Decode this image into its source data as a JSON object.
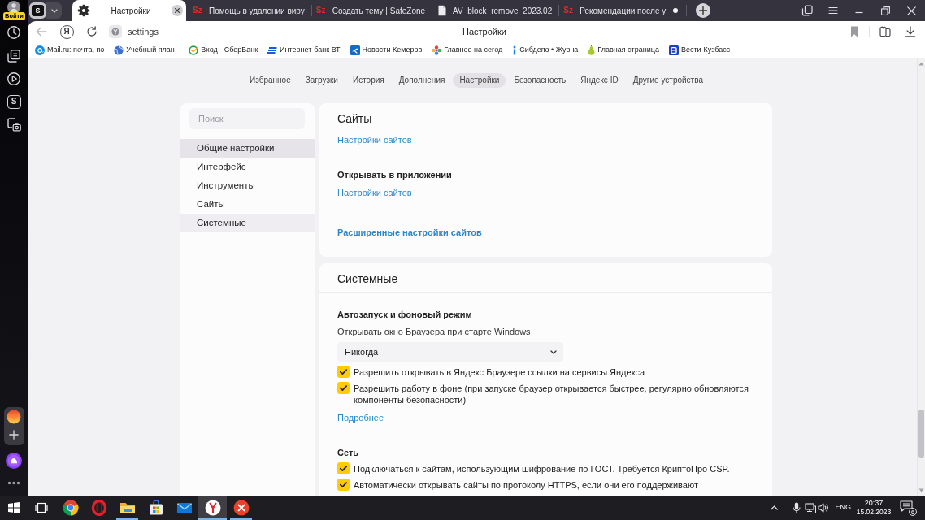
{
  "browser_sidebar": {
    "login_badge": "Войти",
    "panel_letter": "S"
  },
  "tab_strip": {
    "workspace_letter": "S",
    "tabs": [
      {
        "kind": "settings",
        "title": "Настройки",
        "selected": true,
        "unread": false
      },
      {
        "kind": "site",
        "icon_text": "Sz",
        "title": "Помощь в удалении виру",
        "selected": false,
        "unread": false
      },
      {
        "kind": "site",
        "icon_text": "Sz",
        "title": "Создать тему | SafeZone",
        "selected": false,
        "unread": false
      },
      {
        "kind": "document",
        "title": "AV_block_remove_2023.02",
        "selected": false,
        "unread": false
      },
      {
        "kind": "site",
        "icon_text": "Sz",
        "title": "Рекомендации после у",
        "selected": false,
        "unread": true
      }
    ]
  },
  "address_bar": {
    "home_letter": "Я",
    "url": "settings",
    "page_title": "Настройки"
  },
  "bookmarks": [
    {
      "kind": "mail",
      "label": "Mail.ru: почта, по"
    },
    {
      "kind": "globe",
      "label": "Учебный план -"
    },
    {
      "kind": "sber",
      "label": "Вход - СберБанк"
    },
    {
      "kind": "bank",
      "label": "Интернет-банк ВТ"
    },
    {
      "kind": "news",
      "label": "Новости Кемеров"
    },
    {
      "kind": "flower",
      "label": "Главное на сегод"
    },
    {
      "kind": "info",
      "label": "Сибдепо • Журна"
    },
    {
      "kind": "pear",
      "label": "Главная страница"
    },
    {
      "kind": "tile",
      "label": "Вести-Кузбасс"
    }
  ],
  "settings_nav": [
    {
      "label": "Избранное",
      "selected": false
    },
    {
      "label": "Загрузки",
      "selected": false
    },
    {
      "label": "История",
      "selected": false
    },
    {
      "label": "Дополнения",
      "selected": false
    },
    {
      "label": "Настройки",
      "selected": true
    },
    {
      "label": "Безопасность",
      "selected": false
    },
    {
      "label": "Яндекс ID",
      "selected": false
    },
    {
      "label": "Другие устройства",
      "selected": false
    }
  ],
  "settings_menu": {
    "search_placeholder": "Поиск",
    "items": [
      {
        "label": "Общие настройки",
        "selected": true,
        "hovered": false
      },
      {
        "label": "Интерфейс",
        "selected": false,
        "hovered": false
      },
      {
        "label": "Инструменты",
        "selected": false,
        "hovered": false
      },
      {
        "label": "Сайты",
        "selected": false,
        "hovered": false
      },
      {
        "label": "Системные",
        "selected": false,
        "hovered": true
      }
    ]
  },
  "sections": [
    {
      "title": "Сайты",
      "blocks": [
        {
          "kind": "link",
          "text": "Настройки сайтов"
        },
        {
          "kind": "heading",
          "text": "Открывать в приложении"
        },
        {
          "kind": "link",
          "text": "Настройки сайтов"
        },
        {
          "kind": "strong_link",
          "text": "Расширенные настройки сайтов"
        }
      ]
    },
    {
      "title": "Системные",
      "blocks": [
        {
          "kind": "heading",
          "text": "Автозапуск и фоновый режим"
        },
        {
          "kind": "label",
          "text": "Открывать окно Браузера при старте Windows"
        },
        {
          "kind": "select",
          "value": "Никогда"
        },
        {
          "kind": "checkbox",
          "text": "Разрешить открывать в Яндекс Браузере ссылки на сервисы Яндекса",
          "checked": true
        },
        {
          "kind": "checkbox",
          "text": "Разрешить работу в фоне (при запуске браузер открывается быстрее, регулярно обновляются компоненты безопасности)",
          "checked": true
        },
        {
          "kind": "link",
          "text": "Подробнее"
        },
        {
          "kind": "heading",
          "text": "Сеть"
        },
        {
          "kind": "checkbox",
          "text": "Подключаться к сайтам, использующим шифрование по ГОСТ. Требуется КриптоПро CSP.",
          "checked": true
        },
        {
          "kind": "checkbox",
          "text": "Автоматически открывать сайты по протоколу HTTPS, если они его поддерживают",
          "checked": true
        }
      ]
    }
  ],
  "taskbar": {
    "apps": [
      {
        "kind": "chrome",
        "running": false,
        "active": false
      },
      {
        "kind": "opera",
        "running": false,
        "active": false
      },
      {
        "kind": "explorer",
        "running": true,
        "active": false
      },
      {
        "kind": "store",
        "running": false,
        "active": false
      },
      {
        "kind": "mail",
        "running": false,
        "active": false
      },
      {
        "kind": "yandex",
        "running": true,
        "active": true
      },
      {
        "kind": "error_app",
        "running": true,
        "active": false
      }
    ],
    "language": "ENG",
    "time": "20:37",
    "date": "15.02.2023",
    "notification_count": "6"
  }
}
